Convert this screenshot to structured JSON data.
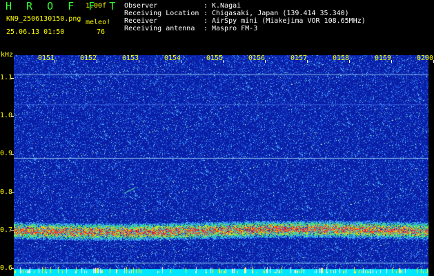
{
  "header": {
    "logo": "H R O F F T",
    "version": "1.00f",
    "filename": "KN9_2506130150.png",
    "meleo_label": "meleo!",
    "datetime": "25.06.13 01:50",
    "count": "76"
  },
  "meta": [
    {
      "key": "Observer",
      "sep": ":",
      "value": "K.Nagai"
    },
    {
      "key": "Receiving Location",
      "sep": ":",
      "value": "Chigasaki, Japan (139.414 35.340)"
    },
    {
      "key": "Receiver",
      "sep": ":",
      "value": "AirSpy mini (Miakejima VOR 108.65MHz)"
    },
    {
      "key": "Receiving antenna",
      "sep": ":",
      "value": "Maspro FM-3"
    }
  ],
  "chart_data": {
    "type": "heatmap",
    "ylabel": "kHz",
    "x_ticks": [
      "0151",
      "0152",
      "0153",
      "0154",
      "0155",
      "0156",
      "0157",
      "0158",
      "0159",
      "0200"
    ],
    "y_ticks": [
      "1.1",
      "1.0",
      "0.9",
      "0.8",
      "0.7",
      "0.6"
    ],
    "y_range": [
      0.58,
      1.16
    ],
    "steady_lines_khz": [
      1.11,
      0.89,
      0.615,
      0.595
    ],
    "dominant_band_khz": 0.7,
    "colors": {
      "background": "#0a1fa8",
      "noise": "#3fa0ff",
      "line": "#9fe0ff",
      "band_hot": "#ff3030",
      "band_warm": "#ffd000"
    }
  }
}
